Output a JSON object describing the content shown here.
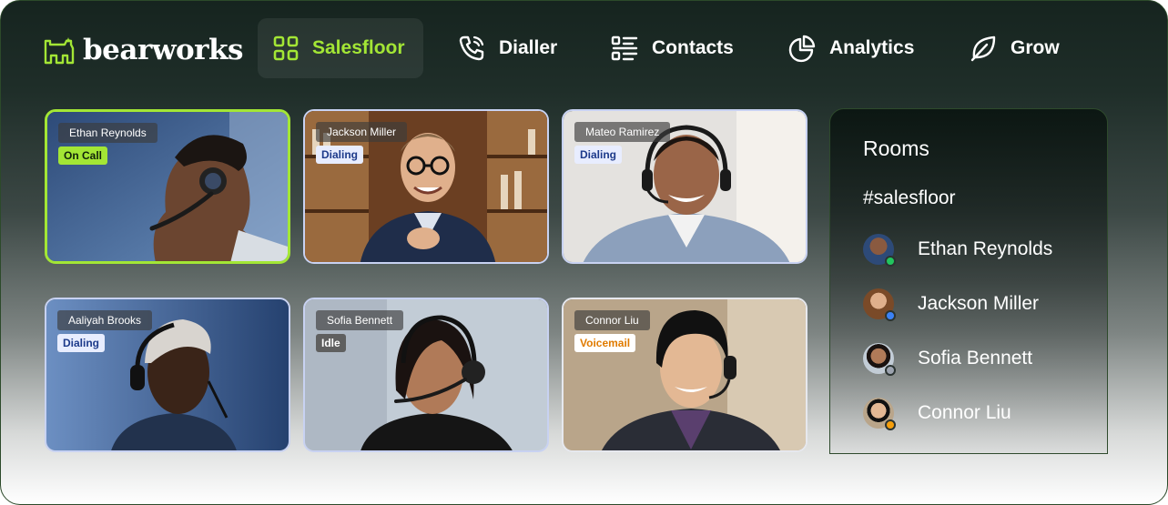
{
  "brand": {
    "name": "bearworks",
    "accent": "#a3e635"
  },
  "nav": [
    {
      "label": "Salesfloor",
      "icon": "grid-icon",
      "active": true
    },
    {
      "label": "Dialler",
      "icon": "phone-icon",
      "active": false
    },
    {
      "label": "Contacts",
      "icon": "list-icon",
      "active": false
    },
    {
      "label": "Analytics",
      "icon": "pie-chart-icon",
      "active": false
    },
    {
      "label": "Grow",
      "icon": "leaf-icon",
      "active": false
    }
  ],
  "tiles": [
    {
      "name": "Ethan Reynolds",
      "status": "On Call",
      "status_style": "oncall",
      "active": true
    },
    {
      "name": "Jackson Miller",
      "status": "Dialing",
      "status_style": "dialing"
    },
    {
      "name": "Mateo Ramirez",
      "status": "Dialing",
      "status_style": "dialing"
    },
    {
      "name": "Aaliyah Brooks",
      "status": "Dialing",
      "status_style": "dialing"
    },
    {
      "name": "Sofia Bennett",
      "status": "Idle",
      "status_style": "idle"
    },
    {
      "name": "Connor Liu",
      "status": "Voicemail",
      "status_style": "voicemail"
    }
  ],
  "status_colors": {
    "oncall": {
      "bg": "#a3e635",
      "fg": "#10220a"
    },
    "dialing": {
      "bg": "#e8edff",
      "fg": "#1d3a8a"
    },
    "idle": {
      "bg": "#5f5f5f",
      "fg": "#ffffff"
    },
    "voicemail": {
      "bg": "#ffffff",
      "fg": "#e07b00"
    }
  },
  "rooms": {
    "title": "Rooms",
    "channel": "#salesfloor",
    "members": [
      {
        "name": "Ethan Reynolds",
        "presence": "#22c55e"
      },
      {
        "name": "Jackson Miller",
        "presence": "#3b82f6"
      },
      {
        "name": "Sofia Bennett",
        "presence": "#9ca3af"
      },
      {
        "name": "Connor Liu",
        "presence": "#f59e0b"
      }
    ]
  }
}
